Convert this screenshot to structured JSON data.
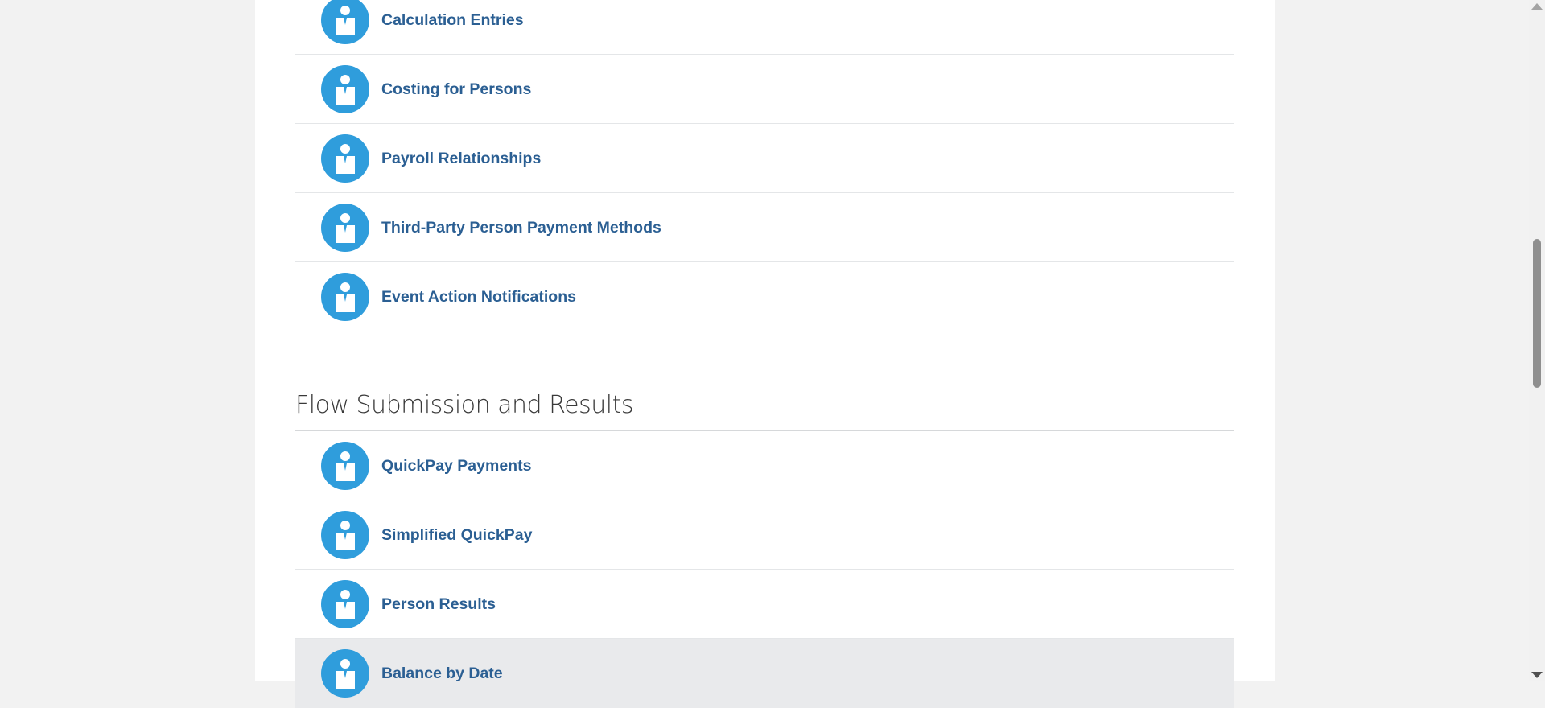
{
  "top_list": {
    "items": [
      {
        "label": "Calculation Entries",
        "icon": "person-icon"
      },
      {
        "label": "Costing for Persons",
        "icon": "person-icon"
      },
      {
        "label": "Payroll Relationships",
        "icon": "person-icon"
      },
      {
        "label": "Third-Party Person Payment Methods",
        "icon": "person-icon"
      },
      {
        "label": "Event Action Notifications",
        "icon": "person-icon"
      }
    ]
  },
  "flow_section": {
    "title": "Flow Submission and Results",
    "items": [
      {
        "label": "QuickPay Payments",
        "icon": "person-icon"
      },
      {
        "label": "Simplified QuickPay",
        "icon": "person-icon"
      },
      {
        "label": "Person Results",
        "icon": "person-icon"
      },
      {
        "label": "Balance by Date",
        "icon": "person-icon"
      }
    ]
  },
  "colors": {
    "icon_bg": "#2f9ddc",
    "link_text": "#2b5f93",
    "hover_row": "#e9eaec"
  }
}
